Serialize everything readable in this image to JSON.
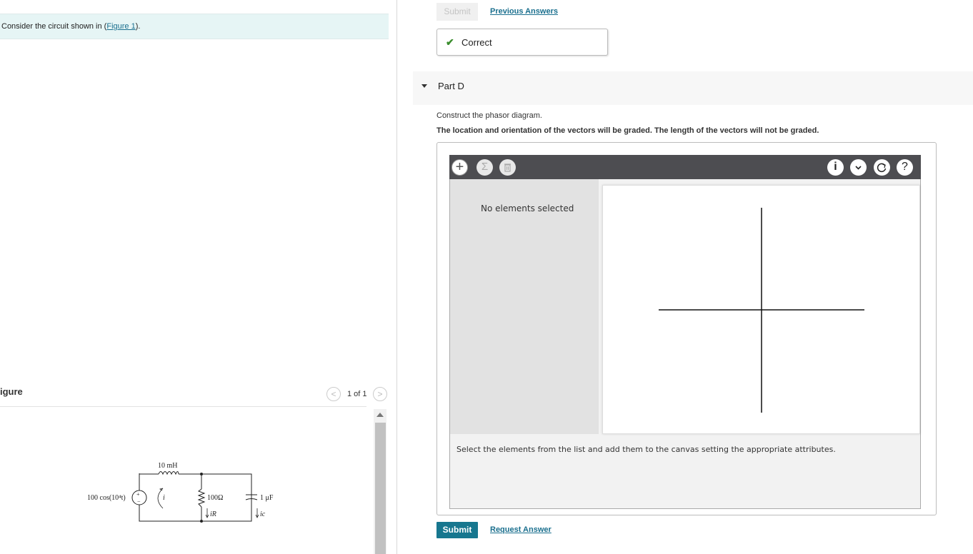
{
  "left_pane": {
    "prompt_prefix": "Consider the circuit shown in (",
    "prompt_link": "Figure 1",
    "prompt_suffix": ").",
    "figure_title": "igure",
    "pager": {
      "prev": "<",
      "text": "1 of 1",
      "next": ">"
    },
    "circuit": {
      "inductor": "10 mH",
      "source": "100 cos(10⁴t)",
      "current_i": "i",
      "resistor": "100Ω",
      "current_r": "iR",
      "capacitor": "1 μF",
      "current_c": "ic"
    }
  },
  "right_pane": {
    "top_submit": "Submit",
    "previous_answers": "Previous Answers",
    "feedback": {
      "icon": "check-icon",
      "text": "Correct"
    },
    "part": {
      "label": "Part D"
    },
    "instruction_1": "Construct the phasor diagram.",
    "instruction_2": "The location and orientation of the vectors will be graded. The length of the vectors will not be graded.",
    "tool": {
      "toolbar_left": [
        "plus-icon",
        "sigma-icon",
        "trash-icon"
      ],
      "toolbar_right": [
        "info-icon",
        "chevron-down-icon",
        "reset-icon",
        "help-icon"
      ],
      "no_selection": "No elements selected",
      "hint": "Select the elements from the list and add them to the canvas setting the appropriate attributes."
    },
    "submit": "Submit",
    "request_answer": "Request Answer"
  },
  "colors": {
    "accent": "#17778f",
    "link": "#1a6f8e",
    "correct": "#3a8d2d",
    "prompt_bg": "#e6f5f5",
    "toolbar_bg": "#4d4d51"
  }
}
